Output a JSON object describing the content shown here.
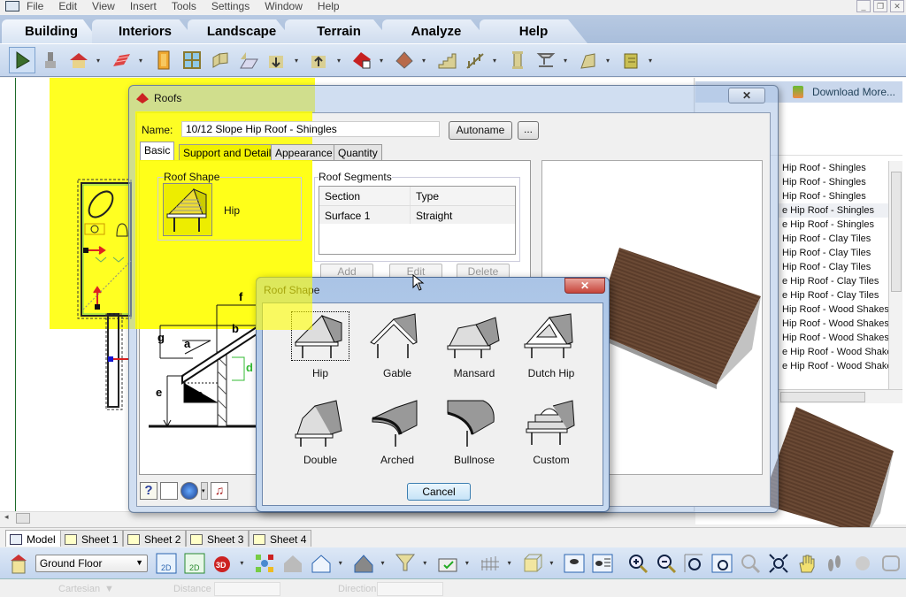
{
  "menu": [
    "File",
    "Edit",
    "View",
    "Insert",
    "Tools",
    "Settings",
    "Window",
    "Help"
  ],
  "window_controls": [
    "minimize",
    "restore",
    "close"
  ],
  "ribbon_tabs": [
    {
      "label": "Building",
      "active": true
    },
    {
      "label": "Interiors",
      "active": false
    },
    {
      "label": "Landscape",
      "active": false
    },
    {
      "label": "Terrain",
      "active": false
    },
    {
      "label": "Analyze",
      "active": false
    },
    {
      "label": "Help",
      "active": false
    }
  ],
  "toolbar": [
    {
      "icon": "select-arrow-icon",
      "selected": true,
      "dropdown": false
    },
    {
      "icon": "paint-brush-icon",
      "dropdown": false
    },
    {
      "icon": "house-icon",
      "dropdown": true
    },
    {
      "icon": "brick-wall-icon",
      "dropdown": true
    },
    {
      "icon": "door-icon",
      "dropdown": false
    },
    {
      "icon": "window-icon",
      "dropdown": false
    },
    {
      "icon": "wall-panel-icon",
      "dropdown": false
    },
    {
      "icon": "floor-icon",
      "dropdown": false
    },
    {
      "icon": "floor-down-icon",
      "dropdown": true
    },
    {
      "icon": "floor-up-icon",
      "dropdown": true
    },
    {
      "icon": "roof-icon",
      "dropdown": true
    },
    {
      "icon": "roof-texture-icon",
      "dropdown": true
    },
    {
      "icon": "stairs-icon",
      "dropdown": false
    },
    {
      "icon": "railing-icon",
      "dropdown": true
    },
    {
      "icon": "column-icon",
      "dropdown": false
    },
    {
      "icon": "beam-icon",
      "dropdown": true
    },
    {
      "icon": "foundation-icon",
      "dropdown": true
    },
    {
      "icon": "cabinet-icon",
      "dropdown": true
    }
  ],
  "library": {
    "download_label": "Download More...",
    "items": [
      {
        "label": "Hip Roof - Shingles",
        "highlight": false
      },
      {
        "label": "Hip Roof - Shingles",
        "highlight": false
      },
      {
        "label": "Hip Roof - Shingles",
        "highlight": false
      },
      {
        "label": "e Hip Roof - Shingles",
        "highlight": true
      },
      {
        "label": "e Hip Roof - Shingles",
        "highlight": false
      },
      {
        "label": "Hip Roof - Clay Tiles",
        "highlight": false
      },
      {
        "label": "Hip Roof - Clay Tiles",
        "highlight": false
      },
      {
        "label": "Hip Roof - Clay Tiles",
        "highlight": false
      },
      {
        "label": "e Hip Roof - Clay Tiles",
        "highlight": false
      },
      {
        "label": "e Hip Roof - Clay Tiles",
        "highlight": false
      },
      {
        "label": "Hip Roof - Wood Shakes",
        "highlight": false
      },
      {
        "label": "Hip Roof - Wood Shakes",
        "highlight": false
      },
      {
        "label": "Hip Roof - Wood Shakes",
        "highlight": false
      },
      {
        "label": "e Hip Roof - Wood Shake",
        "highlight": false
      },
      {
        "label": "e Hip Roof - Wood Shake",
        "highlight": false
      }
    ]
  },
  "roofs_dialog": {
    "title": "Roofs",
    "name_label": "Name:",
    "name_value": "10/12 Slope Hip Roof - Shingles",
    "autoname_label": "Autoname",
    "ellipsis_label": "...",
    "tabs": [
      {
        "label": "Basic",
        "active": true
      },
      {
        "label": "Support and Details",
        "active": false
      },
      {
        "label": "Appearance",
        "active": false
      },
      {
        "label": "Quantity",
        "active": false
      }
    ],
    "roof_shape_label": "Roof Shape",
    "roof_shape_value": "Hip",
    "segments_label": "Roof Segments",
    "segments_columns": [
      "Section",
      "Type"
    ],
    "segments_rows": [
      [
        "Surface 1",
        "Straight"
      ]
    ],
    "add_label": "Add",
    "edit_label": "Edit",
    "delete_label": "Delete",
    "dimension_labels": [
      "a",
      "b",
      "c",
      "d",
      "e",
      "f",
      "g"
    ],
    "footer_icons": [
      "help-icon",
      "page-cursor-icon",
      "globe-icon",
      "music-note-icon"
    ]
  },
  "roof_shape_dialog": {
    "title": "Roof Shape",
    "shapes": [
      {
        "label": "Hip",
        "selected": true
      },
      {
        "label": "Gable",
        "selected": false
      },
      {
        "label": "Mansard",
        "selected": false
      },
      {
        "label": "Dutch Hip",
        "selected": false
      },
      {
        "label": "Double",
        "selected": false
      },
      {
        "label": "Arched",
        "selected": false
      },
      {
        "label": "Bullnose",
        "selected": false
      },
      {
        "label": "Custom",
        "selected": false
      }
    ],
    "cancel_label": "Cancel"
  },
  "sheet_tabs": [
    {
      "label": "Model",
      "active": true
    },
    {
      "label": "Sheet 1",
      "active": false
    },
    {
      "label": "Sheet 2",
      "active": false
    },
    {
      "label": "Sheet 3",
      "active": false
    },
    {
      "label": "Sheet 4",
      "active": false
    }
  ],
  "bottom_toolbar": {
    "floor_value": "Ground Floor",
    "icons": [
      "floors-icon",
      "plan-2d-icon",
      "plan-2d-alt-icon",
      "view-3d-icon",
      "snap-icon",
      "house-shell-icon",
      "house-outline-icon",
      "house-hatch-icon",
      "filter-eye-icon",
      "camera-check-icon",
      "fence-icon",
      "cube-icon",
      "view-eye-icon",
      "view-eye-list-icon",
      "zoom-in-icon",
      "zoom-out-icon",
      "zoom-fit-icon",
      "zoom-window-icon",
      "zoom-icon",
      "zoom-extents-icon",
      "pan-hand-icon",
      "walk-icon",
      "orbit-icon",
      "camera-icon"
    ]
  },
  "status": {
    "coord_mode": "Cartesian",
    "distance_label": "Distance",
    "direction_label": "Direction"
  }
}
